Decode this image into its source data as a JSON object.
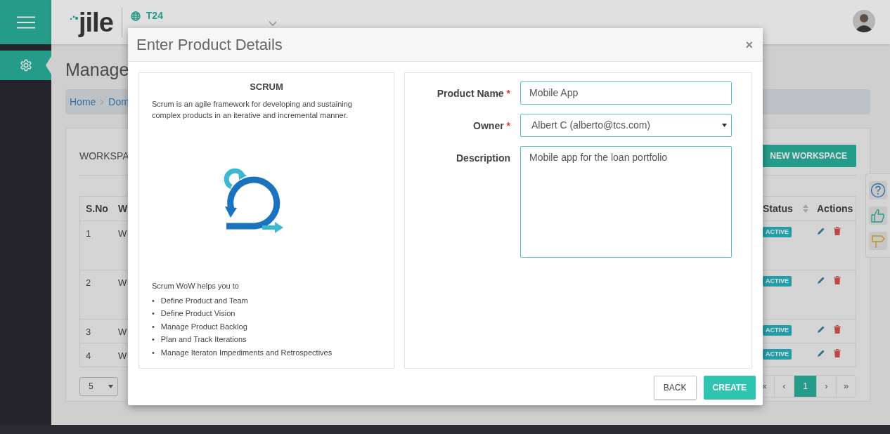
{
  "sidebar": {
    "items": [
      {
        "selected": true
      }
    ]
  },
  "header": {
    "brand": "jile",
    "domain": "T24"
  },
  "page": {
    "title": "Manage",
    "breadcrumb": [
      "Home",
      "Dom"
    ]
  },
  "workspaces": {
    "title": "WORKSPA",
    "new_button": "NEW WORKSPACE",
    "columns": [
      "S.No",
      "W",
      "Status",
      "Actions"
    ],
    "rows": [
      {
        "sno": "1",
        "column_2": "W",
        "status": "ACTIVE"
      },
      {
        "sno": "2",
        "column_2": "W",
        "status": "ACTIVE"
      },
      {
        "sno": "3",
        "column_2": "W",
        "status": "ACTIVE"
      },
      {
        "sno": "4",
        "column_2": "W",
        "status": "ACTIVE"
      }
    ],
    "page_size": "5",
    "pagination": [
      {
        "label": "«",
        "selected": false
      },
      {
        "label": "‹",
        "selected": false
      },
      {
        "label": "1",
        "selected": true
      },
      {
        "label": "›",
        "selected": false
      },
      {
        "label": "»",
        "selected": false
      }
    ]
  },
  "modal": {
    "title": "Enter Product Details",
    "close": "×",
    "method": {
      "heading": "SCRUM",
      "description": "Scrum is an agile framework for developing and sustaining complex products in an iterative and incremental manner.",
      "helps_intro": "Scrum WoW helps you to",
      "helps": [
        {
          "bullet": "•",
          "text": "Define Product and Team"
        },
        {
          "bullet": "•",
          "text": "Define Product Vision"
        },
        {
          "bullet": "•",
          "text": "Manage Product Backlog"
        },
        {
          "bullet": "•",
          "text": "Plan and Track Iterations"
        },
        {
          "bullet": "•",
          "text": "Manage Iteraton Impediments and Retrospectives"
        }
      ]
    },
    "fields": [
      {
        "kind": "input",
        "label": "Product Name",
        "required_mark": "*",
        "value": "Mobile App"
      },
      {
        "kind": "select",
        "label": "Owner",
        "required_mark": "*",
        "value": "Albert C (alberto@tcs.com)"
      },
      {
        "kind": "textarea",
        "label": "Description",
        "value": "Mobile app for the loan portfolio"
      }
    ],
    "buttons": [
      {
        "kind": "secondary",
        "label": "BACK"
      },
      {
        "kind": "primary",
        "label": "CREATE"
      }
    ]
  }
}
